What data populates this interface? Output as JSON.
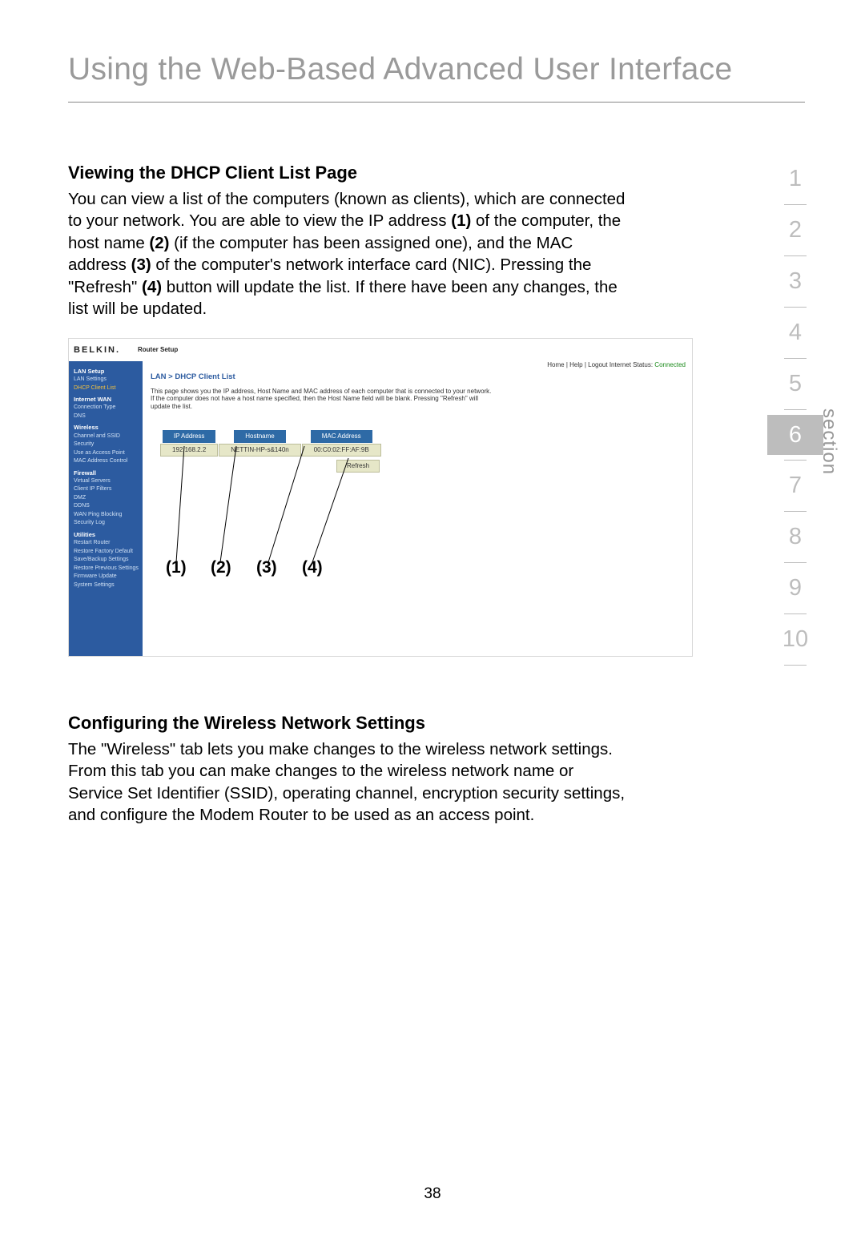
{
  "page_title": "Using the Web-Based Advanced User Interface",
  "section1": {
    "heading": "Viewing the DHCP Client List Page",
    "para": "You can view a list of the computers (known as clients), which are connected to your network. You are able to view the IP address (1) of the computer, the host name (2) (if the computer has been assigned one), and the MAC address (3) of the computer's network interface card (NIC). Pressing the \"Refresh\" (4) button will update the list. If there have been any changes, the list will be updated."
  },
  "section2": {
    "heading": "Configuring the Wireless Network Settings",
    "para": "The \"Wireless\" tab lets you make changes to the wireless network settings. From this tab you can make changes to the wireless network name or Service Set Identifier (SSID), operating channel, encryption security settings, and configure the Modem Router to be used as an access point."
  },
  "screenshot": {
    "logo": "BELKIN.",
    "header_center": "Router Setup",
    "header_right_label": "Home | Help | Logout   Internet Status: ",
    "header_right_status": "Connected",
    "breadcrumb": "LAN > DHCP Client List",
    "desc": "This page shows you the IP address, Host Name and MAC address of each computer that is connected to your network. If the computer does not have a host name specified, then the Host Name field will be blank. Pressing \"Refresh\" will update the list.",
    "columns": {
      "ip": "IP Address",
      "host": "Hostname",
      "mac": "MAC Address"
    },
    "row": {
      "ip": "192.168.2.2",
      "host": "NETTIN-HP-s&140n",
      "mac": "00:C0:02:FF:AF:9B"
    },
    "refresh_label": "Refresh",
    "sidebar": [
      {
        "type": "grp",
        "t": "LAN Setup"
      },
      {
        "type": "itm",
        "t": "LAN Settings"
      },
      {
        "type": "itm orange",
        "t": "DHCP Client List"
      },
      {
        "type": "grp",
        "t": "Internet WAN"
      },
      {
        "type": "itm",
        "t": "Connection Type"
      },
      {
        "type": "itm",
        "t": "DNS"
      },
      {
        "type": "grp",
        "t": "Wireless"
      },
      {
        "type": "itm",
        "t": "Channel and SSID"
      },
      {
        "type": "itm",
        "t": "Security"
      },
      {
        "type": "itm",
        "t": "Use as Access Point"
      },
      {
        "type": "itm",
        "t": "MAC Address Control"
      },
      {
        "type": "grp",
        "t": "Firewall"
      },
      {
        "type": "itm",
        "t": "Virtual Servers"
      },
      {
        "type": "itm",
        "t": "Client IP Filters"
      },
      {
        "type": "itm",
        "t": "DMZ"
      },
      {
        "type": "itm",
        "t": "DDNS"
      },
      {
        "type": "itm",
        "t": "WAN Ping Blocking"
      },
      {
        "type": "itm",
        "t": "Security Log"
      },
      {
        "type": "grp",
        "t": "Utilities"
      },
      {
        "type": "itm",
        "t": "Restart Router"
      },
      {
        "type": "itm",
        "t": "Restore Factory Default"
      },
      {
        "type": "itm",
        "t": "Save/Backup Settings"
      },
      {
        "type": "itm",
        "t": "Restore Previous Settings"
      },
      {
        "type": "itm",
        "t": "Firmware Update"
      },
      {
        "type": "itm",
        "t": "System Settings"
      }
    ]
  },
  "callouts": [
    "(1)",
    "(2)",
    "(3)",
    "(4)"
  ],
  "section_nav": {
    "label": "section",
    "items": [
      "1",
      "2",
      "3",
      "4",
      "5",
      "6",
      "7",
      "8",
      "9",
      "10"
    ],
    "active": "6"
  },
  "page_number": "38"
}
